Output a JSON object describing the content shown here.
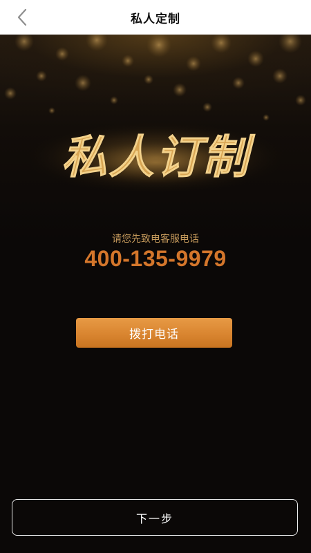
{
  "header": {
    "title": "私人定制",
    "back_icon": "chevron-left-icon"
  },
  "hero": {
    "calligraphy_title": "私人订制"
  },
  "contact": {
    "hint": "请您先致电客服电话",
    "phone": "400-135-9979"
  },
  "actions": {
    "call_label": "拨打电话",
    "next_label": "下一步"
  },
  "colors": {
    "accent_orange": "#d98530",
    "phone_text": "#d4762b",
    "hint_text": "#c69a5c",
    "background": "#0b0807"
  }
}
